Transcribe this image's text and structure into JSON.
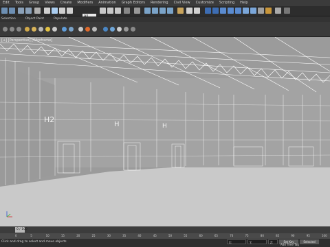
{
  "menubar": {
    "items": [
      "Edit",
      "Tools",
      "Group",
      "Views",
      "Create",
      "Modifiers",
      "Animation",
      "Graph Editors",
      "Rendering",
      "Civil View",
      "Customize",
      "Scripting",
      "Help"
    ]
  },
  "toolbar1": {
    "selection_filter": "All"
  },
  "ribbon": {
    "tabs": [
      "Selection",
      "Object Paint",
      "Populate"
    ]
  },
  "viewport": {
    "label": "[+] [Perspective] [Wireframe]",
    "bays": [
      {
        "label": "H2"
      },
      {
        "label": "H"
      },
      {
        "label": "H"
      }
    ],
    "colors": {
      "background": "#9b9b9b",
      "wireframe": "#ffffff",
      "floor": "#c9c9c9"
    }
  },
  "timeline": {
    "frame_label": "0 / 100",
    "ticks": [
      "0",
      "5",
      "10",
      "15",
      "20",
      "25",
      "30",
      "35",
      "40",
      "45",
      "50",
      "55",
      "60",
      "65",
      "70",
      "75",
      "80",
      "85",
      "90",
      "95",
      "100"
    ]
  },
  "statusbar": {
    "status_text": "None Selected",
    "prompt_text": "Click and drag to select and move objects",
    "set_key_label": "Set Key",
    "selected_label": "Selected",
    "add_time_tag": "Add Time Tag",
    "x_field": "X:",
    "y_field": "Y:",
    "z_field": "Z:"
  }
}
